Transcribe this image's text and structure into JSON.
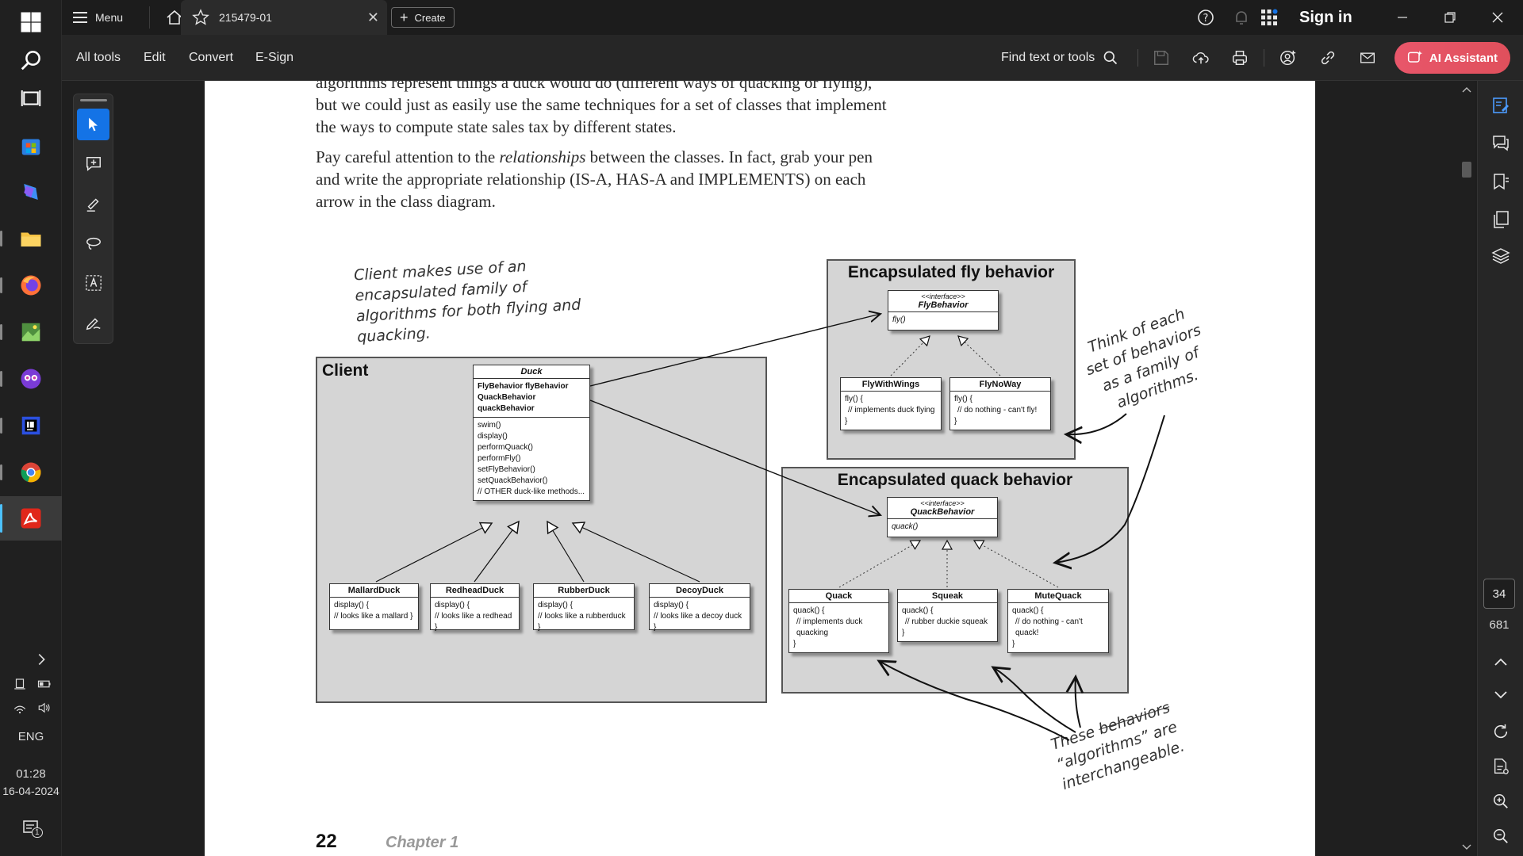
{
  "taskbar": {
    "language": "ENG",
    "time": "01:28",
    "date": "16-04-2024",
    "notification_count": "1"
  },
  "titlebar": {
    "menu_label": "Menu",
    "tab_title": "215479-01",
    "create_label": "Create",
    "sign_in_label": "Sign in"
  },
  "toolbar": {
    "menus": [
      "All tools",
      "Edit",
      "Convert",
      "E-Sign"
    ],
    "find_label": "Find text or tools",
    "ai_label": "AI Assistant"
  },
  "document": {
    "para1": "algorithms represent things a duck would do (different ways of quacking or flying), but we could just as easily use the same techniques for a set of classes that implement the ways to compute state sales tax by different states.",
    "para2_a": "Pay careful attention to the ",
    "para2_em": "relationships",
    "para2_b": " between the classes. In fact, grab your pen and write the appropriate relationship (IS-A, HAS-A and IMPLEMENTS) on each arrow in the class diagram.",
    "note_client": "Client makes use of an encapsulated family of algorithms for both flying and quacking.",
    "note_think": "Think of each set of behaviors as a family of algorithms.",
    "note_these_a": "These ",
    "note_these_strike": "behaviors",
    "note_these_b": " “algorithms” are interchangeable.",
    "page_number": "22",
    "chapter": "Chapter 1"
  },
  "diagram": {
    "client_title": "Client",
    "fly_group_title": "Encapsulated fly behavior",
    "quack_group_title": "Encapsulated quack behavior",
    "interface_stereotype": "<<interface>>",
    "duck": {
      "name": "Duck",
      "fields": [
        "FlyBehavior flyBehavior",
        "QuackBehavior quackBehavior"
      ],
      "methods": [
        "swim()",
        "display()",
        "performQuack()",
        "performFly()",
        "setFlyBehavior()",
        "setQuackBehavior()",
        "// OTHER duck-like methods..."
      ]
    },
    "subclasses": [
      {
        "name": "MallardDuck",
        "body": [
          "display() {",
          "// looks like a mallard }"
        ]
      },
      {
        "name": "RedheadDuck",
        "body": [
          "display() {",
          "// looks like a redhead }"
        ]
      },
      {
        "name": "RubberDuck",
        "body": [
          "display() {",
          "// looks like a rubberduck }"
        ]
      },
      {
        "name": "DecoyDuck",
        "body": [
          "display() {",
          "// looks like a decoy duck }"
        ]
      }
    ],
    "fly_interface": {
      "name": "FlyBehavior",
      "method": "fly()"
    },
    "fly_impls": [
      {
        "name": "FlyWithWings",
        "body": [
          "fly() {",
          "// implements duck flying",
          "}"
        ]
      },
      {
        "name": "FlyNoWay",
        "body": [
          "fly() {",
          "// do nothing - can't fly!",
          "}"
        ]
      }
    ],
    "quack_interface": {
      "name": "QuackBehavior",
      "method": "quack()"
    },
    "quack_impls": [
      {
        "name": "Quack",
        "body": [
          "quack() {",
          "// implements duck quacking",
          "}"
        ]
      },
      {
        "name": "Squeak",
        "body": [
          "quack() {",
          "// rubber duckie squeak",
          "}"
        ]
      },
      {
        "name": "MuteQuack",
        "body": [
          "quack() {",
          "// do nothing - can't quack!",
          "}"
        ]
      }
    ]
  },
  "pager": {
    "current_page": "34",
    "total_pages": "681"
  },
  "colors": {
    "accent": "#1473e6",
    "ai_button": "#e0505c"
  }
}
